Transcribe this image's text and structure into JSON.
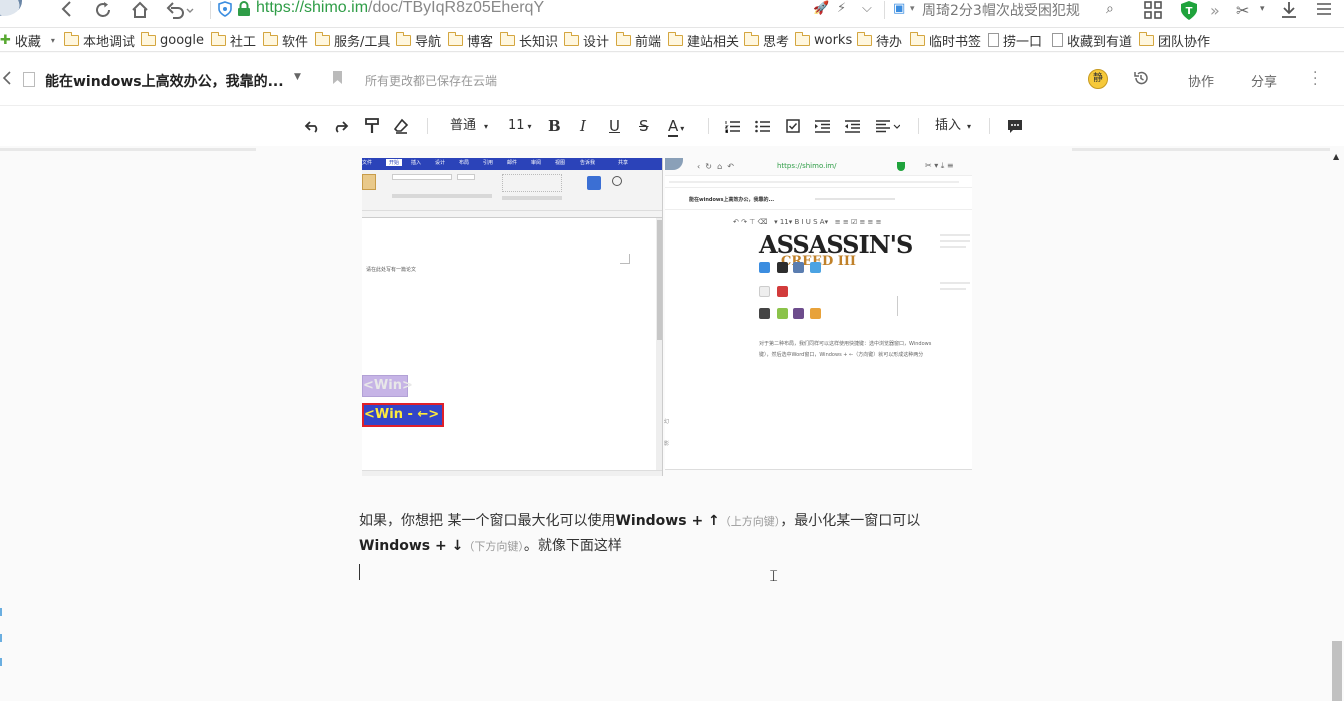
{
  "browser": {
    "url_host": "https://shimo.im",
    "url_path": "/doc/TByIqR8z05EherqY",
    "search_text": "周琦2分3帽次战受困犯规"
  },
  "bookmarks": {
    "favorites_label": "收藏",
    "items": [
      "本地调试",
      "google",
      "社工",
      "软件",
      "服务/工具",
      "导航",
      "博客",
      "长知识",
      "设计",
      "前端",
      "建站相关",
      "思考",
      "works",
      "待办",
      "临时书签",
      "捞一口",
      "收藏到有道",
      "团队协作"
    ]
  },
  "doc_header": {
    "title": "能在windows上高效办公，我靠的...",
    "save_status": "所有更改都已保存在云端",
    "avatar_text": "静",
    "collab_label": "协作",
    "share_label": "分享"
  },
  "toolbar": {
    "style_label": "普通",
    "font_size": "11",
    "insert_label": "插入"
  },
  "screenshot_left": {
    "ribbon_tabs": [
      "文件",
      "开始",
      "插入",
      "设计",
      "布局",
      "引用",
      "邮件",
      "审阅",
      "视图",
      "告诉我",
      "共享"
    ],
    "body_text": "请在此处写有一篇论文",
    "key_a": "<Win>",
    "key_b": "<Win - ←>"
  },
  "screenshot_right": {
    "url": "https://shimo.im/",
    "doc_title": "能在windows上高效办公，我靠的...",
    "logo_main": "ASSASSIN'S",
    "logo_sub": "CREED III",
    "caption_1": "对于第二种布局，我们同样可以这样使用快捷键：选中浏览器窗口，Windows",
    "caption_2": "键），然后选中Word窗口，Windows + ←（方向键）就可以形成这种两分"
  },
  "body": {
    "line1_a": "如果，你想把 某一个窗口最大化可以使用",
    "line1_key": "Windows + ↑",
    "line1_hint": "（上方向键）",
    "line1_b": "，最小化某一窗口可以",
    "line2_key": "Windows + ↓",
    "line2_hint": "（下方向键）",
    "line2_b": "。就像下面这样"
  }
}
